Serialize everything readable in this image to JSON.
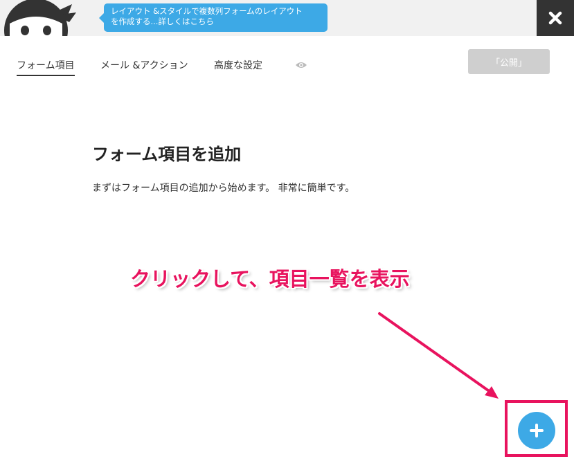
{
  "header": {
    "tooltip_line1": "レイアウト &スタイルで複数列フォームのレイアウト",
    "tooltip_line2": "を作成する...詳しくはこちら"
  },
  "tabs": [
    {
      "label": "フォーム項目",
      "active": true
    },
    {
      "label": "メール &アクション",
      "active": false
    },
    {
      "label": "高度な設定",
      "active": false
    }
  ],
  "publish_label": "「公開」",
  "main": {
    "heading": "フォーム項目を追加",
    "description": "まずはフォーム項目の追加から始めます。 非常に簡単です。"
  },
  "annotation": {
    "text": "クリックして、項目一覧を表示",
    "color": "#e8135e"
  },
  "colors": {
    "accent": "#3da9e6",
    "close_bg": "#333333",
    "publish_disabled": "#cfcfcf"
  },
  "icons": {
    "close": "close-icon",
    "preview": "eye-icon",
    "add": "plus-icon",
    "mascot": "ninja-mascot"
  }
}
